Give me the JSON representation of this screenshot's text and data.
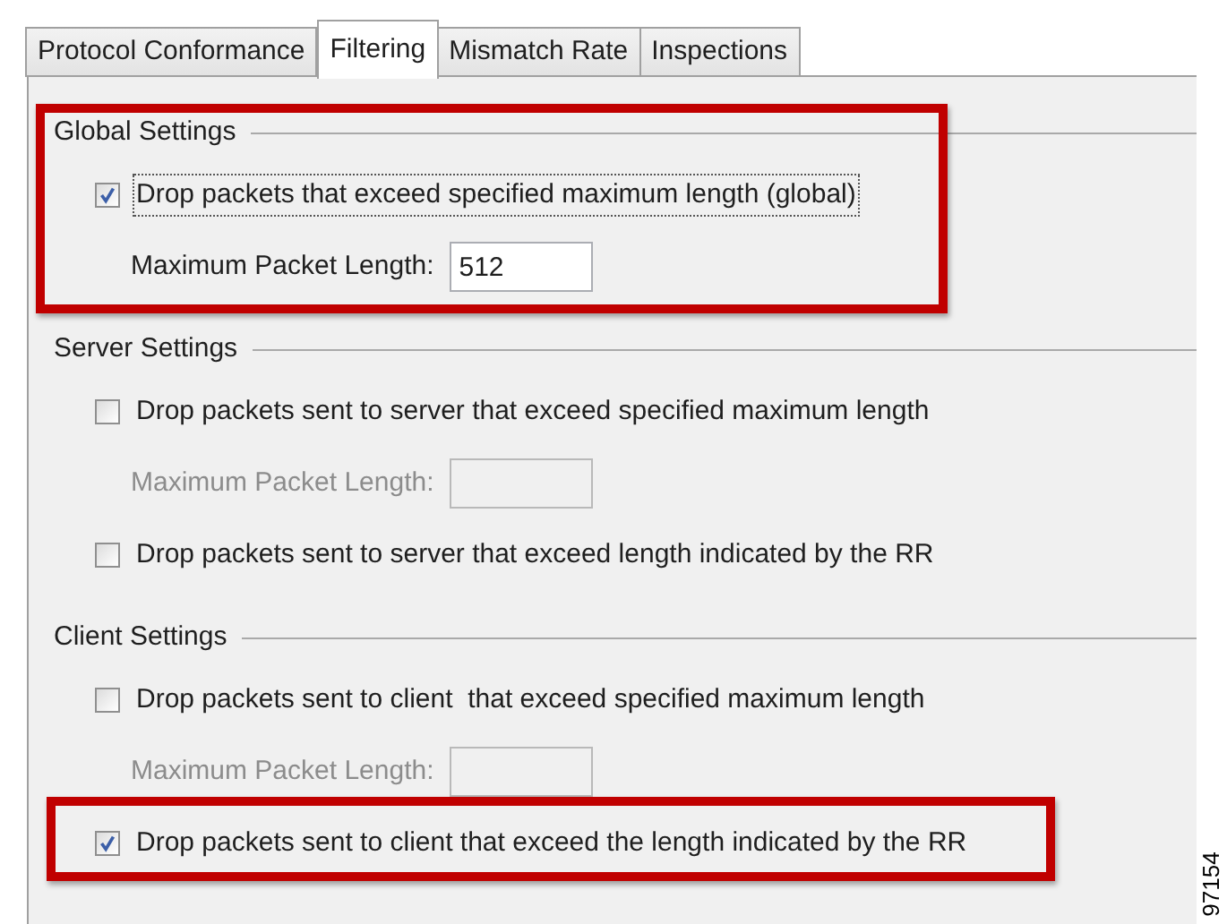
{
  "tabs": [
    {
      "label": "Protocol Conformance",
      "selected": false
    },
    {
      "label": "Filtering",
      "selected": true
    },
    {
      "label": "Mismatch Rate",
      "selected": false
    },
    {
      "label": "Inspections",
      "selected": false
    }
  ],
  "sections": [
    {
      "title": "Global Settings",
      "highlighted": true,
      "items": [
        {
          "kind": "checkbox",
          "label": "Drop packets that exceed specified maximum length (global)",
          "checked": true,
          "focused": true,
          "highlighted": false
        },
        {
          "kind": "field",
          "label": "Maximum Packet Length:",
          "value": "512",
          "disabled": false,
          "highlighted": false
        }
      ]
    },
    {
      "title": "Server Settings",
      "highlighted": false,
      "items": [
        {
          "kind": "checkbox",
          "label": "Drop packets sent to server that exceed specified maximum length",
          "checked": false,
          "focused": false,
          "highlighted": false
        },
        {
          "kind": "field",
          "label": "Maximum Packet Length:",
          "disabled": true,
          "highlighted": false
        },
        {
          "kind": "checkbox",
          "label": "Drop packets sent to server that exceed length indicated by the RR",
          "checked": false,
          "focused": false,
          "highlighted": false
        }
      ]
    },
    {
      "title": "Client Settings",
      "highlighted": false,
      "items": [
        {
          "kind": "checkbox",
          "label": "Drop packets sent to client  that exceed specified maximum length",
          "checked": false,
          "focused": false,
          "highlighted": false
        },
        {
          "kind": "field",
          "label": "Maximum Packet Length:",
          "disabled": true,
          "highlighted": false
        },
        {
          "kind": "checkbox",
          "label": "Drop packets sent to client that exceed the length indicated by the RR",
          "checked": true,
          "focused": false,
          "highlighted": true
        }
      ]
    }
  ],
  "figure_number": "97154"
}
